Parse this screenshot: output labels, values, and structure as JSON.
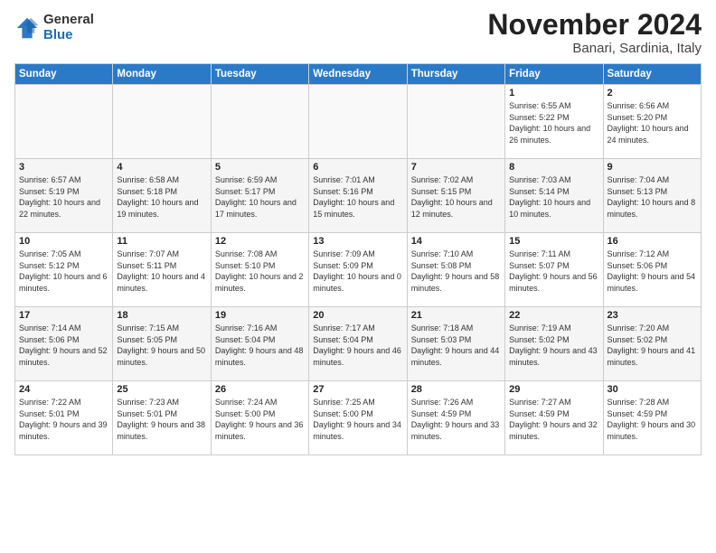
{
  "header": {
    "logo_general": "General",
    "logo_blue": "Blue",
    "month_title": "November 2024",
    "location": "Banari, Sardinia, Italy"
  },
  "days_of_week": [
    "Sunday",
    "Monday",
    "Tuesday",
    "Wednesday",
    "Thursday",
    "Friday",
    "Saturday"
  ],
  "weeks": [
    [
      {
        "day": "",
        "info": ""
      },
      {
        "day": "",
        "info": ""
      },
      {
        "day": "",
        "info": ""
      },
      {
        "day": "",
        "info": ""
      },
      {
        "day": "",
        "info": ""
      },
      {
        "day": "1",
        "info": "Sunrise: 6:55 AM\nSunset: 5:22 PM\nDaylight: 10 hours and 26 minutes."
      },
      {
        "day": "2",
        "info": "Sunrise: 6:56 AM\nSunset: 5:20 PM\nDaylight: 10 hours and 24 minutes."
      }
    ],
    [
      {
        "day": "3",
        "info": "Sunrise: 6:57 AM\nSunset: 5:19 PM\nDaylight: 10 hours and 22 minutes."
      },
      {
        "day": "4",
        "info": "Sunrise: 6:58 AM\nSunset: 5:18 PM\nDaylight: 10 hours and 19 minutes."
      },
      {
        "day": "5",
        "info": "Sunrise: 6:59 AM\nSunset: 5:17 PM\nDaylight: 10 hours and 17 minutes."
      },
      {
        "day": "6",
        "info": "Sunrise: 7:01 AM\nSunset: 5:16 PM\nDaylight: 10 hours and 15 minutes."
      },
      {
        "day": "7",
        "info": "Sunrise: 7:02 AM\nSunset: 5:15 PM\nDaylight: 10 hours and 12 minutes."
      },
      {
        "day": "8",
        "info": "Sunrise: 7:03 AM\nSunset: 5:14 PM\nDaylight: 10 hours and 10 minutes."
      },
      {
        "day": "9",
        "info": "Sunrise: 7:04 AM\nSunset: 5:13 PM\nDaylight: 10 hours and 8 minutes."
      }
    ],
    [
      {
        "day": "10",
        "info": "Sunrise: 7:05 AM\nSunset: 5:12 PM\nDaylight: 10 hours and 6 minutes."
      },
      {
        "day": "11",
        "info": "Sunrise: 7:07 AM\nSunset: 5:11 PM\nDaylight: 10 hours and 4 minutes."
      },
      {
        "day": "12",
        "info": "Sunrise: 7:08 AM\nSunset: 5:10 PM\nDaylight: 10 hours and 2 minutes."
      },
      {
        "day": "13",
        "info": "Sunrise: 7:09 AM\nSunset: 5:09 PM\nDaylight: 10 hours and 0 minutes."
      },
      {
        "day": "14",
        "info": "Sunrise: 7:10 AM\nSunset: 5:08 PM\nDaylight: 9 hours and 58 minutes."
      },
      {
        "day": "15",
        "info": "Sunrise: 7:11 AM\nSunset: 5:07 PM\nDaylight: 9 hours and 56 minutes."
      },
      {
        "day": "16",
        "info": "Sunrise: 7:12 AM\nSunset: 5:06 PM\nDaylight: 9 hours and 54 minutes."
      }
    ],
    [
      {
        "day": "17",
        "info": "Sunrise: 7:14 AM\nSunset: 5:06 PM\nDaylight: 9 hours and 52 minutes."
      },
      {
        "day": "18",
        "info": "Sunrise: 7:15 AM\nSunset: 5:05 PM\nDaylight: 9 hours and 50 minutes."
      },
      {
        "day": "19",
        "info": "Sunrise: 7:16 AM\nSunset: 5:04 PM\nDaylight: 9 hours and 48 minutes."
      },
      {
        "day": "20",
        "info": "Sunrise: 7:17 AM\nSunset: 5:04 PM\nDaylight: 9 hours and 46 minutes."
      },
      {
        "day": "21",
        "info": "Sunrise: 7:18 AM\nSunset: 5:03 PM\nDaylight: 9 hours and 44 minutes."
      },
      {
        "day": "22",
        "info": "Sunrise: 7:19 AM\nSunset: 5:02 PM\nDaylight: 9 hours and 43 minutes."
      },
      {
        "day": "23",
        "info": "Sunrise: 7:20 AM\nSunset: 5:02 PM\nDaylight: 9 hours and 41 minutes."
      }
    ],
    [
      {
        "day": "24",
        "info": "Sunrise: 7:22 AM\nSunset: 5:01 PM\nDaylight: 9 hours and 39 minutes."
      },
      {
        "day": "25",
        "info": "Sunrise: 7:23 AM\nSunset: 5:01 PM\nDaylight: 9 hours and 38 minutes."
      },
      {
        "day": "26",
        "info": "Sunrise: 7:24 AM\nSunset: 5:00 PM\nDaylight: 9 hours and 36 minutes."
      },
      {
        "day": "27",
        "info": "Sunrise: 7:25 AM\nSunset: 5:00 PM\nDaylight: 9 hours and 34 minutes."
      },
      {
        "day": "28",
        "info": "Sunrise: 7:26 AM\nSunset: 4:59 PM\nDaylight: 9 hours and 33 minutes."
      },
      {
        "day": "29",
        "info": "Sunrise: 7:27 AM\nSunset: 4:59 PM\nDaylight: 9 hours and 32 minutes."
      },
      {
        "day": "30",
        "info": "Sunrise: 7:28 AM\nSunset: 4:59 PM\nDaylight: 9 hours and 30 minutes."
      }
    ]
  ]
}
